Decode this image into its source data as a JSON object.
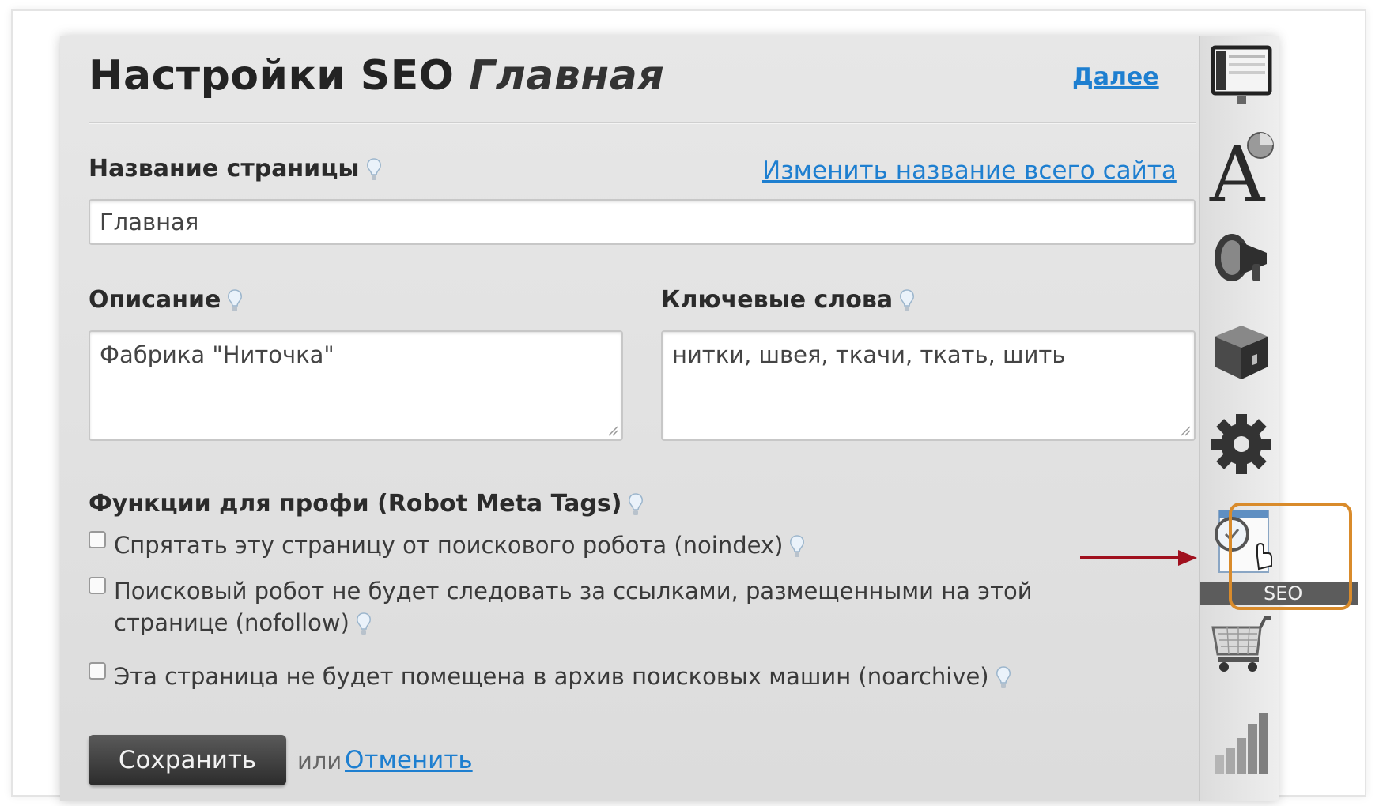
{
  "header": {
    "title": "Настройки SEO",
    "page_name": "Главная",
    "next_link": "Далее"
  },
  "page_title_field": {
    "label": "Название страницы",
    "change_site_link": "Изменить название всего сайта",
    "value": "Главная"
  },
  "description": {
    "label": "Описание",
    "value": "Фабрика \"Ниточка\""
  },
  "keywords": {
    "label": "Ключевые слова",
    "value": "нитки, швея, ткачи, ткать, шить"
  },
  "robot_meta": {
    "label": "Функции для профи (Robot Meta Tags)",
    "options": [
      {
        "text": "Спрятать эту страницу от поискового робота (noindex)",
        "checked": false
      },
      {
        "text": "Поисковый робот не будет следовать за ссылками, размещенными на этой странице (nofollow)",
        "checked": false
      },
      {
        "text": "Эта страница не будет помещена в архив поисковых машин (noarchive)",
        "checked": false
      }
    ]
  },
  "actions": {
    "save_label": "Сохранить",
    "or_text": "или",
    "cancel_label": "Отменить"
  },
  "sidebar": {
    "active_item": "seo",
    "seo_label": "SEO",
    "items": [
      "layout-icon",
      "font-icon",
      "megaphone-icon",
      "box-icon",
      "gear-icon",
      "seo-icon",
      "cart-icon",
      "stats-icon"
    ]
  },
  "colors": {
    "link": "#1e7fd0",
    "highlight_border": "#d98b2b",
    "arrow": "#a0101e"
  }
}
